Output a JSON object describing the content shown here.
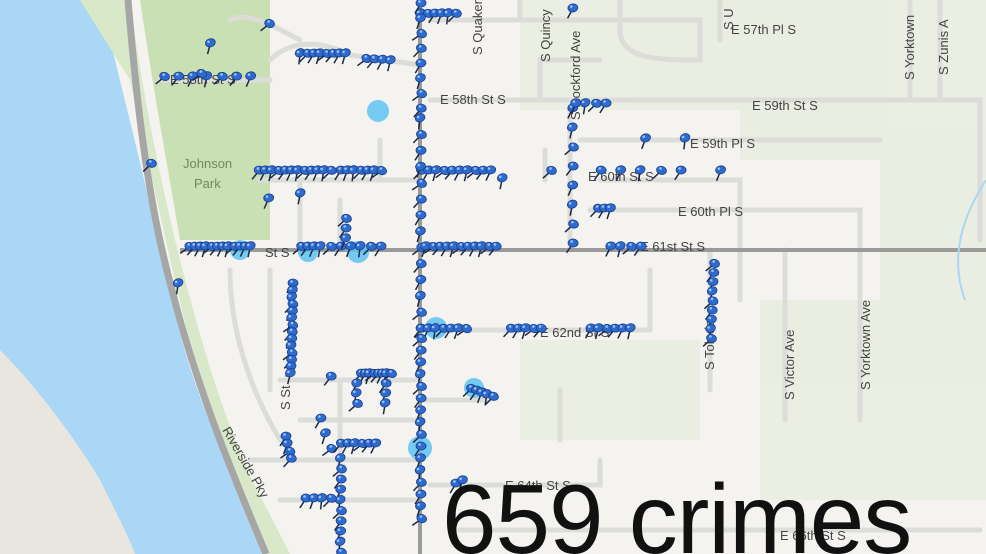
{
  "map": {
    "park_name_line1": "Johnson",
    "park_name_line2": "Park",
    "streets": {
      "e57th_pl": "E 57th Pl S",
      "e58th_st": "E 58th St S",
      "e58th_st_left": "E 58th St S",
      "e59th_st": "E 59th St S",
      "e59th_pl": "E 59th Pl S",
      "e60th_st": "E 60th St S",
      "e60th_pl": "E 60th Pl S",
      "e61st_st": "E 61st St S",
      "e61st_st_left": "St S",
      "e62nd_st": "E 62nd St S",
      "e64th_st": "E 64th St S",
      "e66th_st": "E 66th St S",
      "quaker": "S Quaker",
      "quincy": "S Quincy",
      "rockford": "S Rockford Ave",
      "s_u": "S U",
      "yorktown_top": "S Yorktown",
      "zunis": "S Zunis A",
      "victor": "S Victor Ave",
      "yorktown_ave": "S Yorktown Ave",
      "toledo": "S Toledo",
      "st_left": "S St",
      "riverside": "Riverside Pky"
    },
    "caption": "659 crimes",
    "colors": {
      "water": "#a9d7f5",
      "park": "#c9dfb4",
      "land": "#f4f3ef",
      "road_major": "#9a9a9a",
      "road_minor": "#dcdcd8",
      "pin": "#2f6bcf",
      "cluster": "#5ec3f2"
    },
    "marker_icon": "pushpin-icon"
  }
}
